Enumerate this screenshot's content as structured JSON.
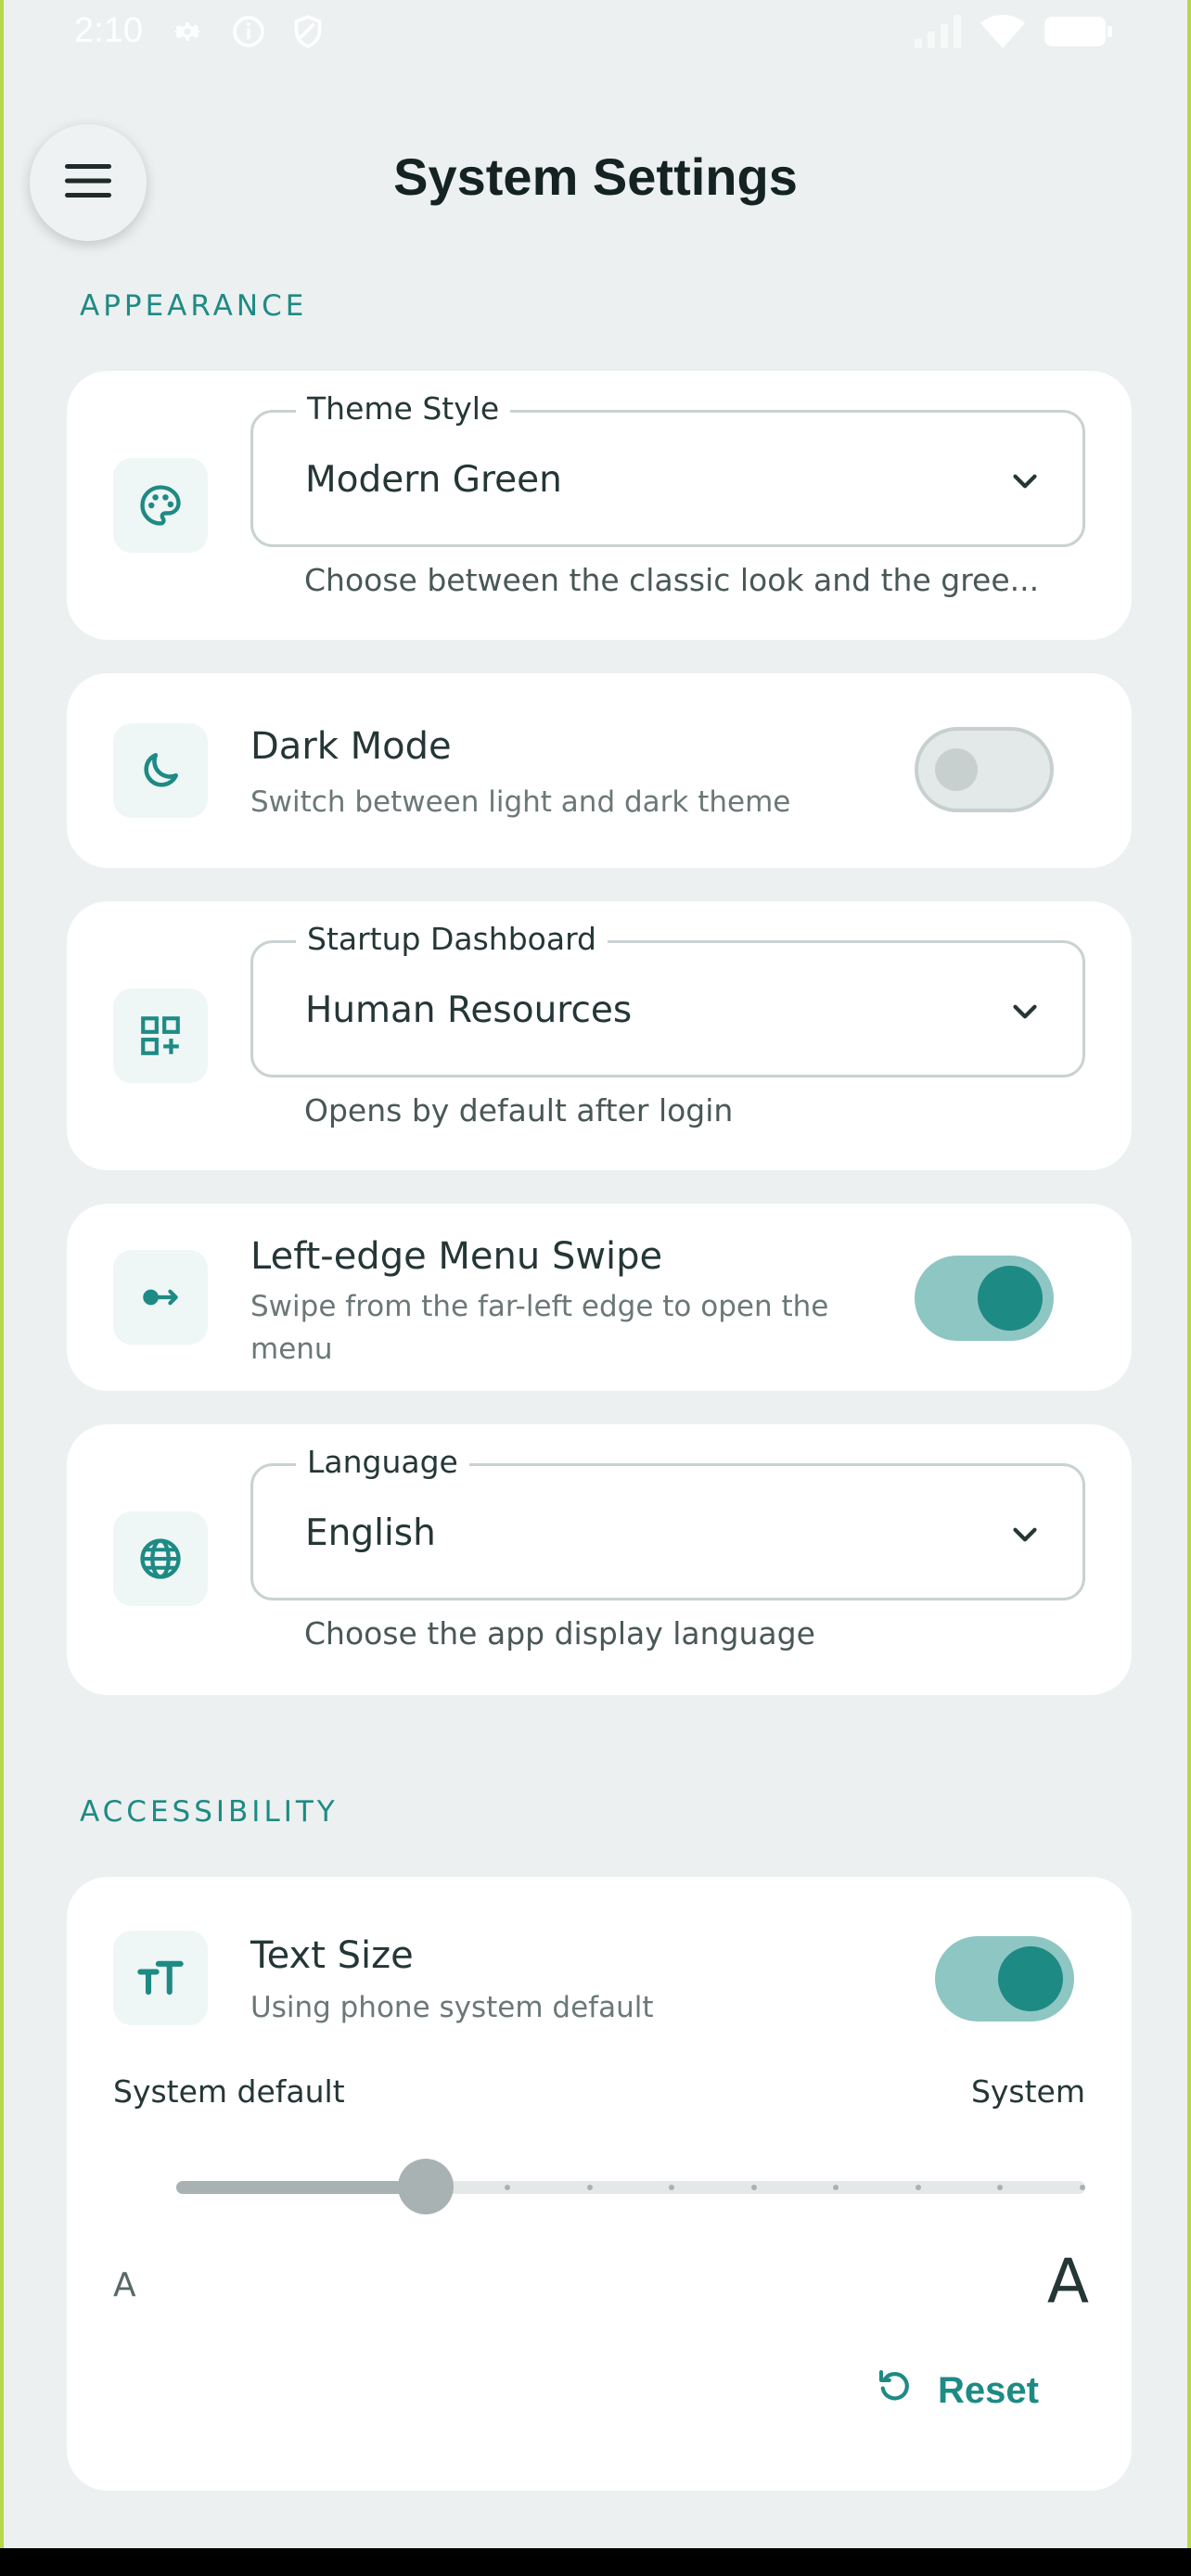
{
  "status_bar": {
    "time": "2:10",
    "icons": [
      "gear-icon",
      "info-icon",
      "shield-icon",
      "signal-icon",
      "wifi-icon",
      "battery-icon"
    ]
  },
  "header": {
    "menu_icon": "hamburger-icon",
    "title": "System Settings"
  },
  "sections": {
    "appearance": "APPEARANCE",
    "accessibility": "ACCESSIBILITY"
  },
  "theme_style": {
    "icon": "palette-icon",
    "label": "Theme Style",
    "value": "Modern Green",
    "helper": "Choose between the classic look and the gree..."
  },
  "dark_mode": {
    "icon": "moon-icon",
    "title": "Dark Mode",
    "subtitle": "Switch between light and dark theme",
    "enabled": false
  },
  "startup_dashboard": {
    "icon": "dashboard-add-icon",
    "label": "Startup Dashboard",
    "value": "Human Resources",
    "helper": "Opens by default after login"
  },
  "menu_swipe": {
    "icon": "swipe-right-icon",
    "title": "Left-edge Menu Swipe",
    "subtitle_line1": "Swipe from the far-left edge to open the",
    "subtitle_line2": "menu",
    "enabled": true
  },
  "language": {
    "icon": "globe-icon",
    "label": "Language",
    "value": "English",
    "helper": "Choose the app display language"
  },
  "text_size": {
    "icon": "text-size-icon",
    "title": "Text Size",
    "subtitle": "Using phone system default",
    "enabled": true,
    "left_label": "System default",
    "right_label": "System",
    "slider_steps": 12,
    "slider_value_index": 3,
    "small_a": "A",
    "large_a": "A",
    "reset_label": "Reset"
  },
  "colors": {
    "accent": "#1E8A84",
    "background": "#ECF0F0",
    "card": "#FFFFFF",
    "toggle_on_track": "#8EC6C3",
    "frame": "#B6D84A"
  }
}
